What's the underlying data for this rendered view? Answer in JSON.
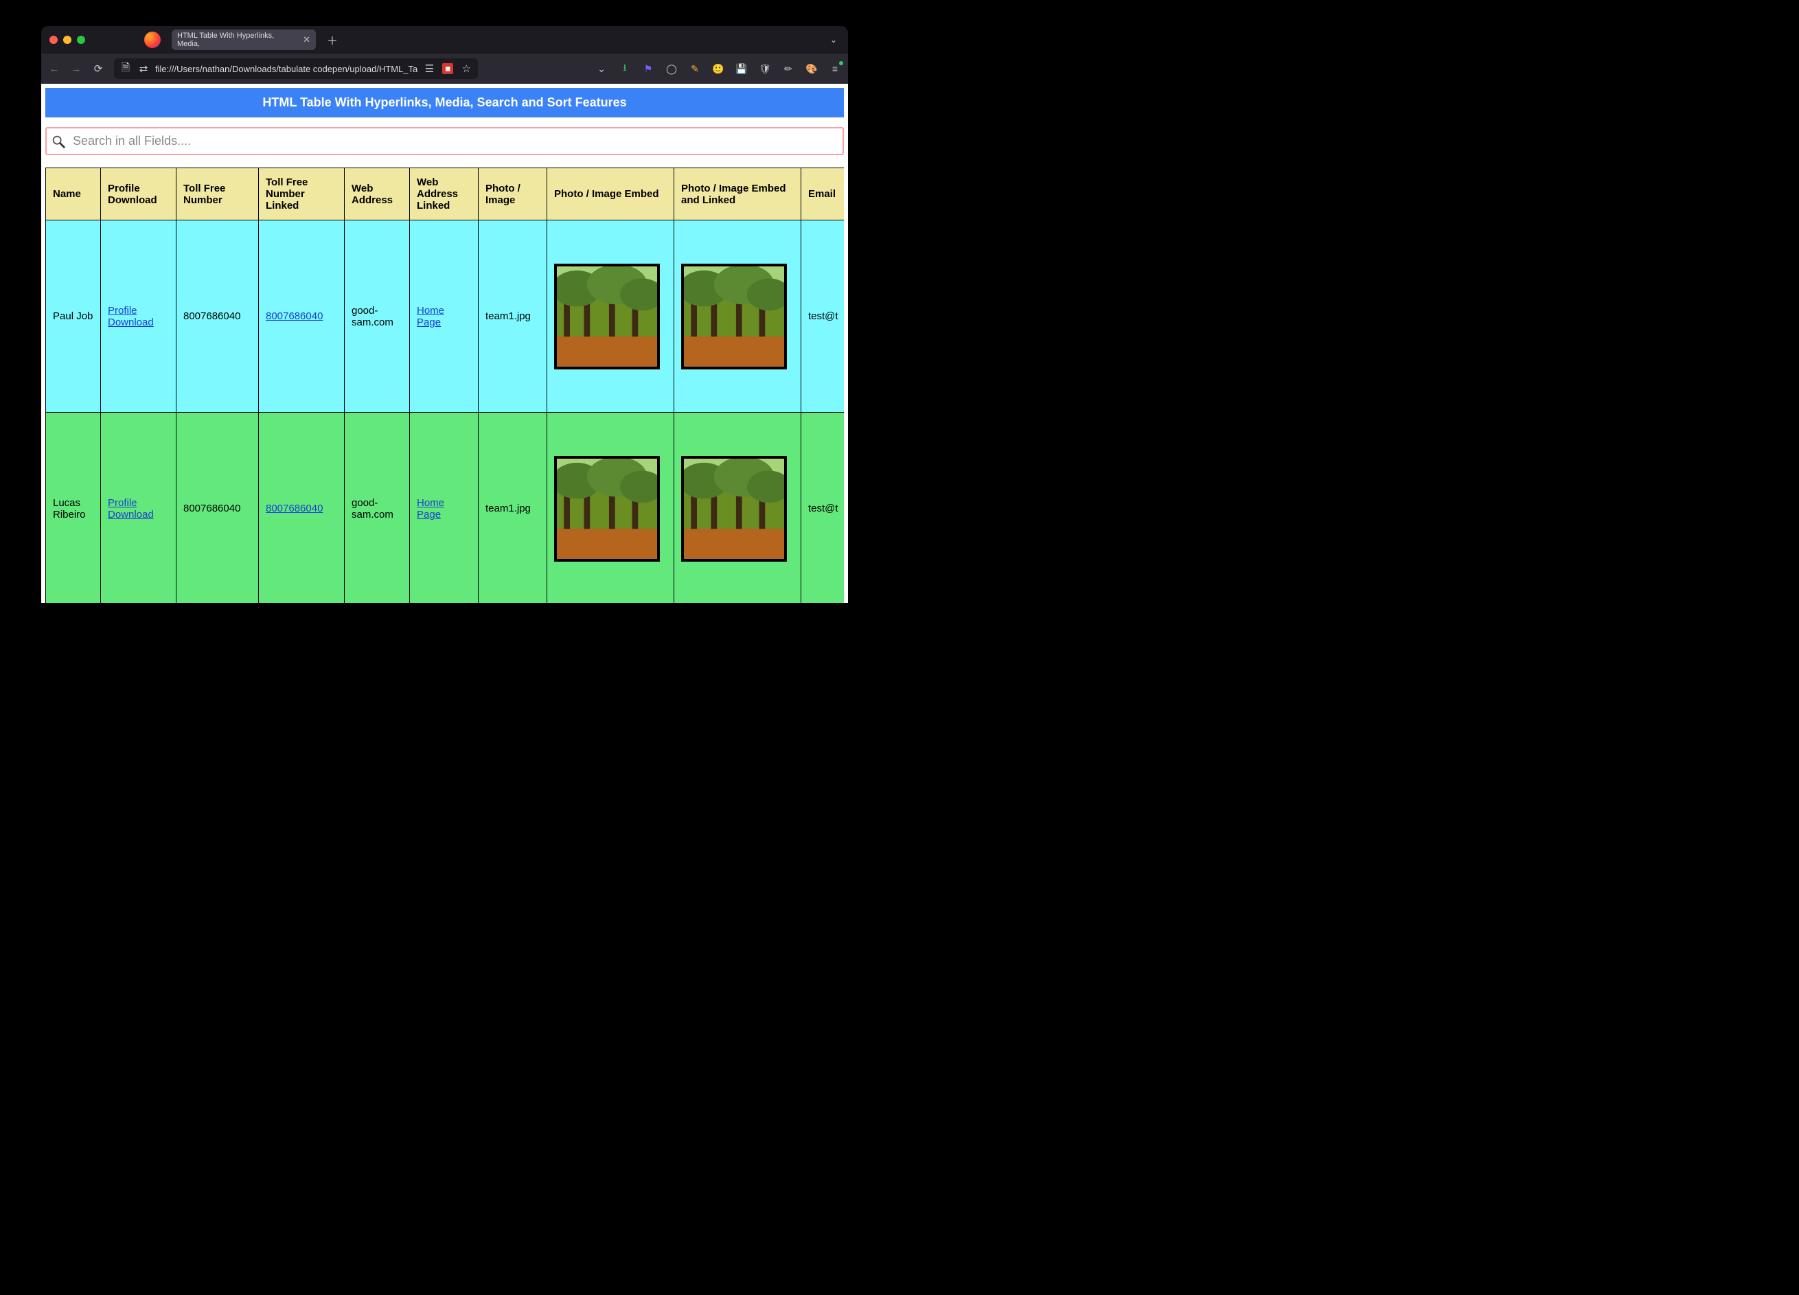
{
  "browser": {
    "tab_title": "HTML Table With Hyperlinks, Media,",
    "url": "file:///Users/nathan/Downloads/tabulate codepen/upload/HTML_Ta"
  },
  "page": {
    "banner": "HTML Table With Hyperlinks, Media, Search and Sort Features",
    "search_placeholder": "Search in all Fields....",
    "columns": [
      "Name",
      "Profile Download",
      "Toll Free Number",
      "Toll Free Number Linked",
      "Web Address",
      "Web Address Linked",
      "Photo / Image",
      "Photo / Image Embed",
      "Photo / Image Embed and Linked",
      "Email"
    ],
    "rows": [
      {
        "name": "Paul Job",
        "profile_download": "Profile Download",
        "toll_free": "8007686040",
        "toll_free_linked": "8007686040",
        "web_address": "good-sam.com",
        "web_address_linked": "Home Page",
        "photo": "team1.jpg",
        "email": "test@t"
      },
      {
        "name": "Lucas Ribeiro",
        "profile_download": "Profile Download",
        "toll_free": "8007686040",
        "toll_free_linked": "8007686040",
        "web_address": "good-sam.com",
        "web_address_linked": "Home Page",
        "photo": "team1.jpg",
        "email": "test@t"
      }
    ]
  },
  "colors": {
    "banner_bg": "#3b82f6",
    "header_bg": "#f0e7a1",
    "row_cyan": "#7df9ff",
    "row_green": "#63e87c",
    "link": "#1a3fd6"
  }
}
